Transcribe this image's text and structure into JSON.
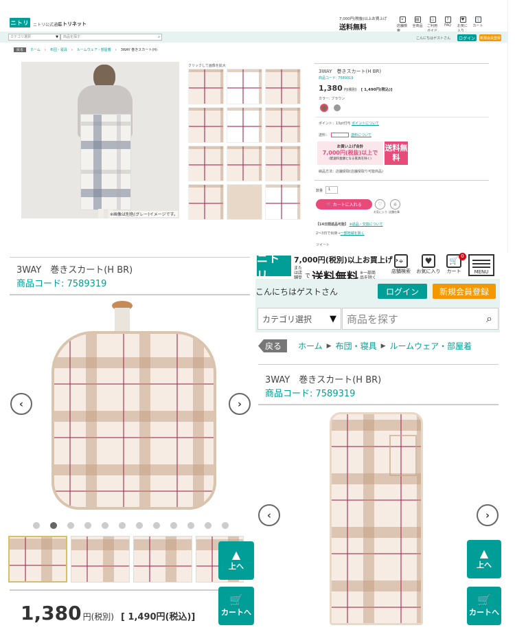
{
  "colors": {
    "brand": "#009e96",
    "accent_pink": "#e84a7a",
    "orange": "#f39800",
    "red": "#e60012"
  },
  "top": {
    "brand_subtitle": "ニトリ公式通販",
    "brand_name": "ニトリネット",
    "logo": "ニトリ",
    "promo_line1": "7,000円(税抜)以上お買上げ",
    "promo_line2": "送料無料",
    "icons": [
      {
        "name": "store-icon",
        "label": "店舗検索"
      },
      {
        "name": "catalog-icon",
        "label": "全商品"
      },
      {
        "name": "guide-icon",
        "label": "ご利用ガイド"
      },
      {
        "name": "faq-icon",
        "label": "FAQ"
      },
      {
        "name": "favorite-icon",
        "label": "お気に入り"
      },
      {
        "name": "cart-icon",
        "label": "カート"
      }
    ],
    "greeting": "こんにちはゲストさん",
    "login": "ログイン",
    "register": "新規会員登録",
    "category_placeholder": "カテゴリ選択",
    "search_placeholder": "商品を探す",
    "breadcrumb": {
      "back": "戻る",
      "items": [
        "ホーム",
        "布団・寝具",
        "ルームウェア・部屋着",
        "3WAY 巻きスカート(H)"
      ]
    },
    "click_hint": "クリックして画像を拡大",
    "image_caption": "※画像は別色(グレー)イメージです。",
    "title": "3WAY　巻きスカート(H BR)",
    "code": "商品コード: 7589319",
    "price": "1,380",
    "price_unit": "円(税別)",
    "price_tax": "[ 1,490円(税込)]",
    "color_label": "カラー: ブラウン",
    "point": "ポイント：13pt付与 ",
    "point_link": "ポイントについて",
    "shipping_label": "送料：",
    "shipping_link": "送料について",
    "banner_line1": "お買い上げ合計",
    "banner_amount": "7,000円(税抜)以上で",
    "banner_note": "(配送料金額となる家具を除く)",
    "banner_free": "送料無料",
    "pickup": "納品方法：店舗受取(店舗受取り可能商品)",
    "qty_label": "数量",
    "qty": "1",
    "add_cart": "カートに入れる",
    "fav": "お気に入り",
    "compare": "店舗在庫",
    "return_label": "【14日間返品可能】",
    "return_link": "※返品・交換について",
    "delivery": "2〜3日で出荷→",
    "delivery_link": "一部地域を除く",
    "tweet": "ツイート"
  },
  "bl": {
    "title": "3WAY　巻きスカート(H BR)",
    "code": "商品コード: 7589319",
    "prev": "‹",
    "next": "›",
    "active_dot": 1,
    "dot_count": 12,
    "price": "1,380",
    "price_unit": "円(税別)",
    "price_tax": "[ 1,490円(税込)]",
    "to_top": "上へ",
    "to_cart": "カートへ"
  },
  "br": {
    "logo": "ニトリ",
    "promo_top": "7,000円(税別)以上お買上げ ›",
    "promo_store": "または店舗受取",
    "promo_de": "で",
    "promo_free": "送料無料",
    "promo_note": "※一部商品を除く",
    "icons": [
      {
        "name": "store-search-icon",
        "label": "店舗検索"
      },
      {
        "name": "favorite-icon",
        "label": "お気に入り"
      },
      {
        "name": "cart-icon",
        "label": "カート",
        "badge": "0"
      }
    ],
    "menu": "MENU",
    "greeting": "こんにちはゲストさん",
    "login": "ログイン",
    "register": "新規会員登録",
    "category": "カテゴリ選択",
    "search_placeholder": "商品を探す",
    "back": "戻る",
    "crumbs": [
      "ホーム",
      "布団・寝具",
      "ルームウェア・部屋着"
    ],
    "title": "3WAY　巻きスカート(H BR)",
    "code": "商品コード: 7589319",
    "prev": "‹",
    "next": "›",
    "to_top": "上へ",
    "to_cart": "カートへ"
  }
}
